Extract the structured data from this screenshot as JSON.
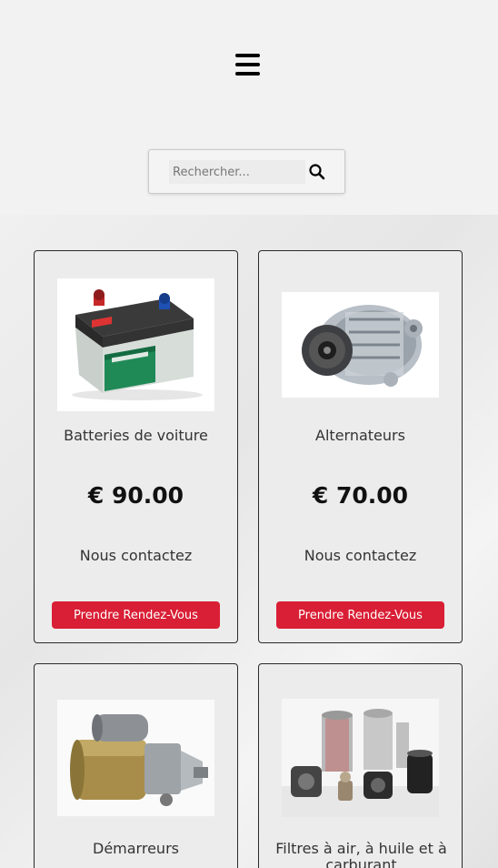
{
  "header": {
    "menu_icon": "hamburger-menu-icon",
    "search": {
      "placeholder": "Rechercher...",
      "value": "",
      "icon": "search-icon"
    }
  },
  "products": [
    {
      "title": "Batteries de voiture",
      "price": "€ 90.00",
      "contact": "Nous contactez",
      "button": "Prendre Rendez-Vous",
      "image": "car-battery-image"
    },
    {
      "title": "Alternateurs",
      "price": "€ 70.00",
      "contact": "Nous contactez",
      "button": "Prendre Rendez-Vous",
      "image": "alternator-image"
    },
    {
      "title": "Démarreurs",
      "image": "starter-motor-image"
    },
    {
      "title": "Filtres à air, à huile et à carburant",
      "image": "filters-image"
    }
  ],
  "colors": {
    "accent": "#d91f35",
    "background": "#f2f2f2",
    "card_background": "#ececec",
    "card_border": "#2a2a2a"
  }
}
